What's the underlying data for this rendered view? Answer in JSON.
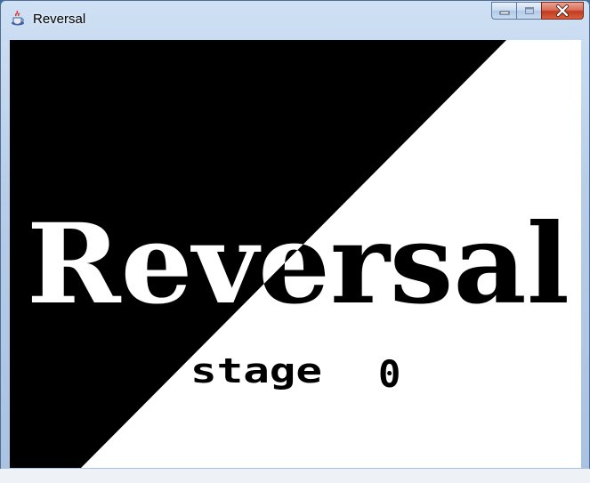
{
  "window": {
    "title": "Reversal",
    "app_icon": "java-cup-icon",
    "controls": {
      "minimize": "minimize-icon",
      "maximize": "maximize-icon",
      "close": "close-icon"
    }
  },
  "game": {
    "logo": "Reversal",
    "stage_label": "stage",
    "stage_number": "0",
    "colors": {
      "dark": "#000000",
      "light": "#ffffff"
    }
  }
}
